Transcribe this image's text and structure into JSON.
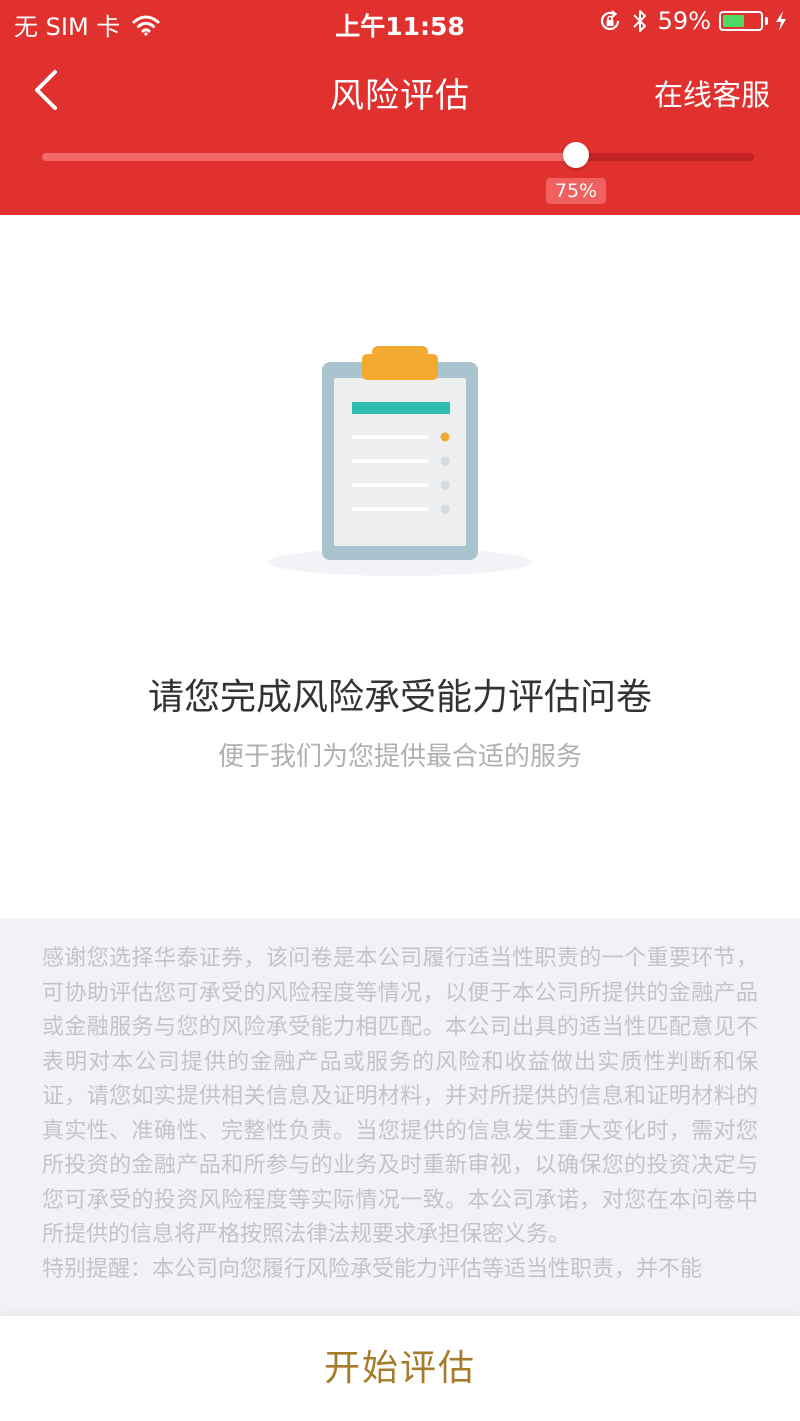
{
  "status_bar": {
    "carrier": "无 SIM 卡",
    "time": "上午11:58",
    "battery_percent": "59%",
    "battery_level": 0.59,
    "battery_color": "#4cd964"
  },
  "nav": {
    "title": "风险评估",
    "service_label": "在线客服",
    "background_color": "#e0312f"
  },
  "progress": {
    "value": 0.75,
    "label": "75%"
  },
  "illustration": {
    "icon": "clipboard-checklist-icon",
    "colors": {
      "clip": "#f3a830",
      "board": "#a9c4cf",
      "header_bar": "#2fbfb2",
      "bullet_active": "#f3a830"
    }
  },
  "content": {
    "title": "请您完成风险承受能力评估问卷",
    "subtitle": "便于我们为您提供最合适的服务"
  },
  "disclaimer": {
    "paragraph1": "感谢您选择华泰证券，该问卷是本公司履行适当性职责的一个重要环节，可协助评估您可承受的风险程度等情况，以便于本公司所提供的金融产品或金融服务与您的风险承受能力相匹配。本公司出具的适当性匹配意见不表明对本公司提供的金融产品或服务的风险和收益做出实质性判断和保证，请您如实提供相关信息及证明材料，并对所提供的信息和证明材料的真实性、准确性、完整性负责。当您提供的信息发生重大变化时，需对您所投资的金融产品和所参与的业务及时重新审视，以确保您的投资决定与您可承受的投资风险程度等实际情况一致。本公司承诺，对您在本问卷中所提供的信息将严格按照法律法规要求承担保密义务。",
    "paragraph2": "特别提醒：本公司向您履行风险承受能力评估等适当性职责，并不能"
  },
  "footer": {
    "start_label": "开始评估",
    "accent_color": "#a67c2a"
  }
}
